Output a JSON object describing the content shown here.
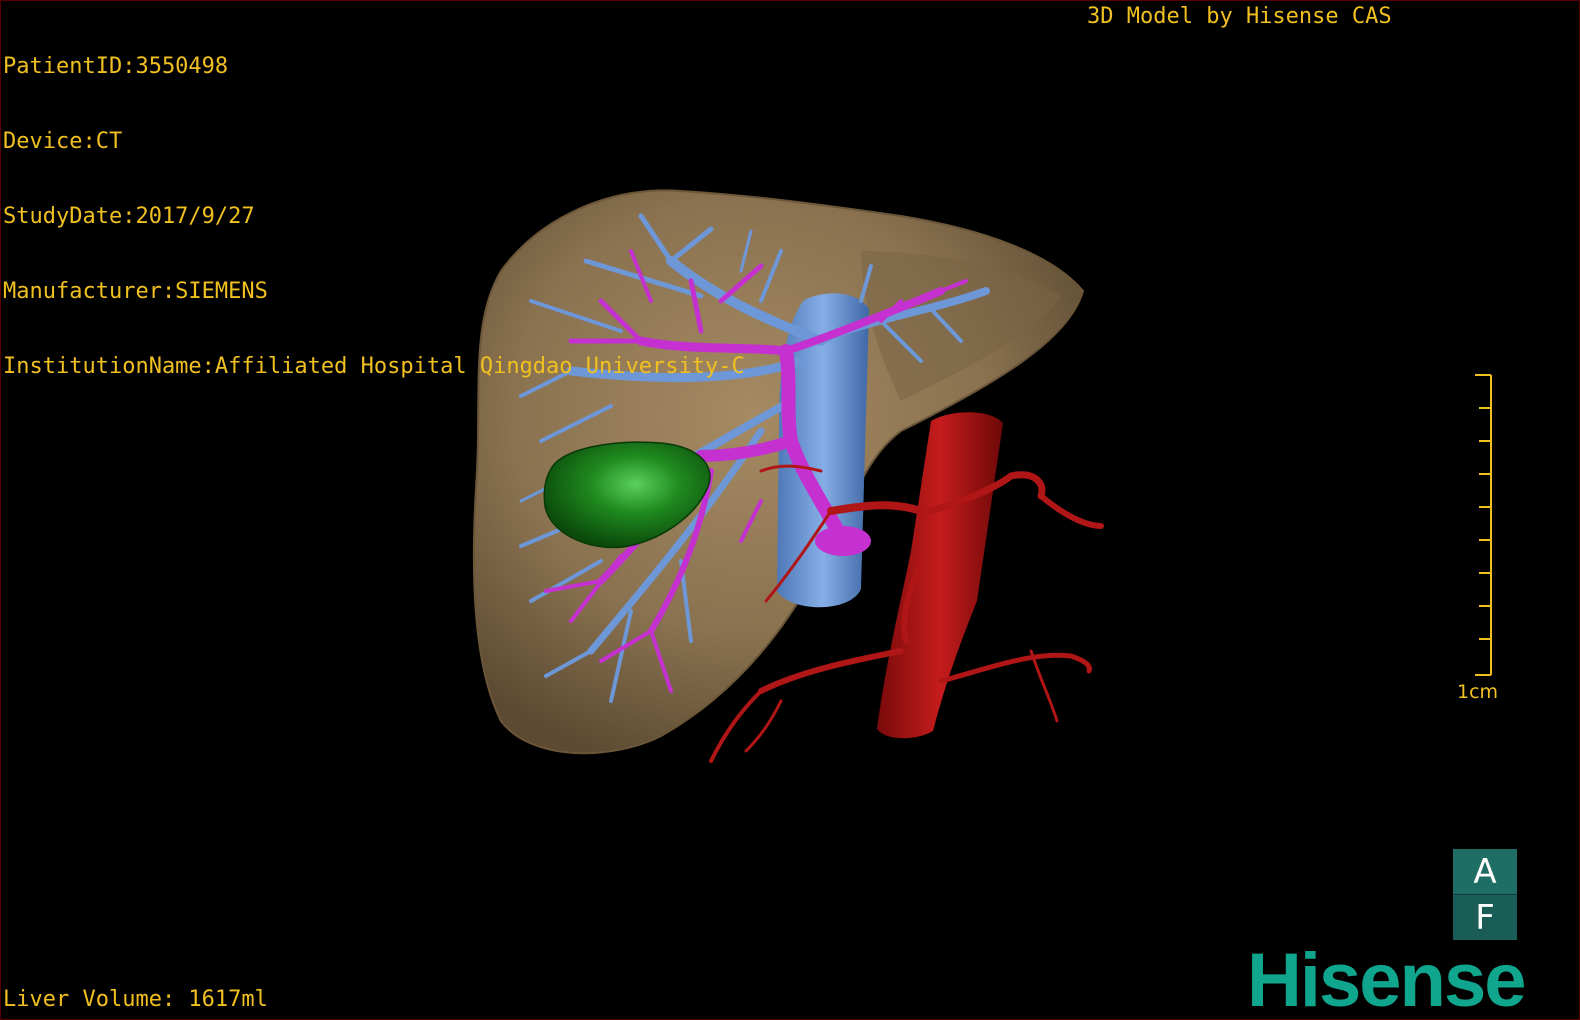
{
  "header": {
    "patient_id": "PatientID:3550498",
    "device": "Device:CT",
    "study_date": "StudyDate:2017/9/27",
    "manufacturer": "Manufacturer:SIEMENS",
    "institution": "InstitutionName:Affiliated Hospital Qingdao University-C"
  },
  "brand_line": "3D Model by Hisense CAS",
  "footer": {
    "liver_volume": "Liver Volume: 1617ml"
  },
  "scale_bar": {
    "label": "1cm"
  },
  "orientation": {
    "top_face": "A",
    "bottom_face": "F"
  },
  "logo_text": "Hisense",
  "colors": {
    "overlay_text": "#f0c020",
    "liver": "#8a7250",
    "portal_vein": "#c530d0",
    "hepatic_vein": "#6d97d6",
    "artery": "#b01616",
    "lesion": "#1f8a1f",
    "logo": "#10a58d"
  },
  "icons": [
    "orientation-cube-icon",
    "scale-bar-icon",
    "hisense-logo"
  ]
}
